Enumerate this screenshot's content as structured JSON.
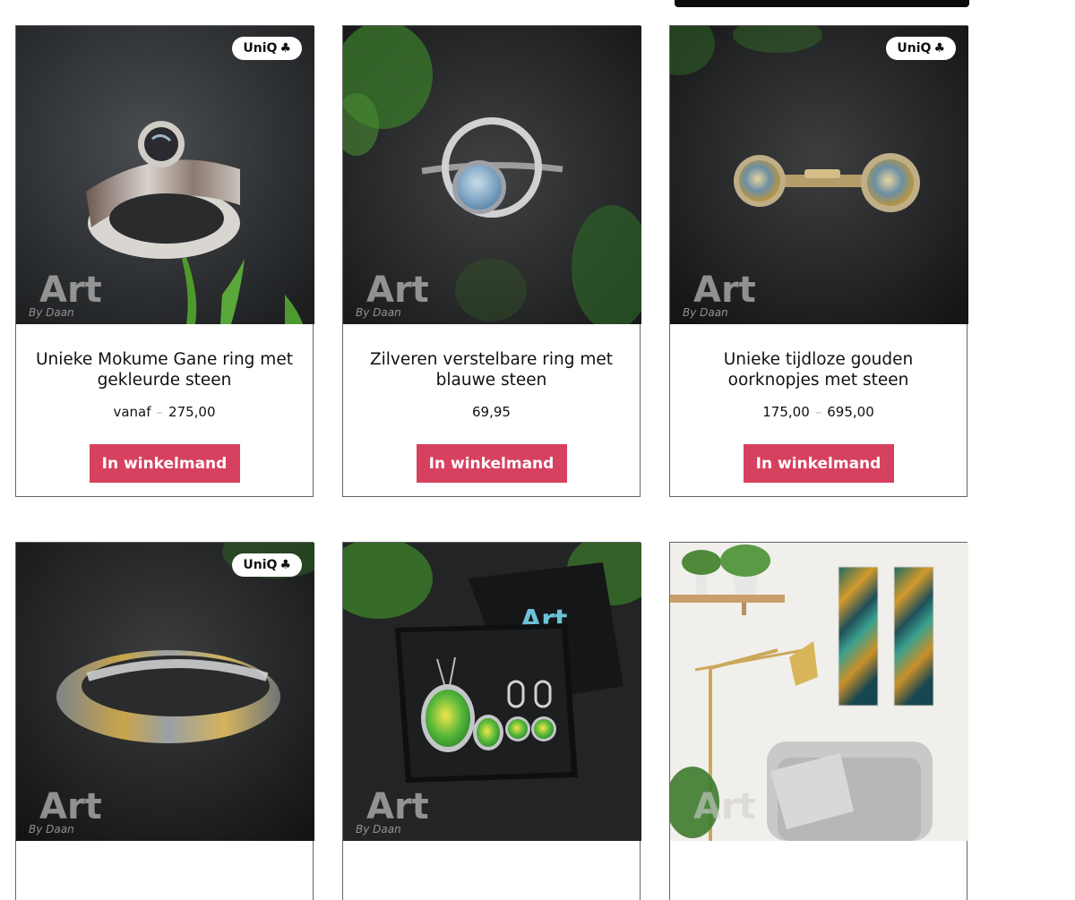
{
  "badge": {
    "label": "UniQ",
    "icon": "club-icon",
    "glyph": "♣"
  },
  "watermark": {
    "main": "Art",
    "sub": "By Daan"
  },
  "colors": {
    "button": "#d6415f",
    "card_border": "#666666"
  },
  "products": [
    {
      "title": "Unieke Mokume Gane ring met gekleurde steen",
      "price_prefix": "vanaf",
      "price_from": "",
      "price_to": "275,00",
      "button": "In winkelmand",
      "badge": true
    },
    {
      "title": "Zilveren verstelbare ring met blauwe steen",
      "price_prefix": "",
      "price_from": "",
      "price_to": "69,95",
      "button": "In winkelmand",
      "badge": false
    },
    {
      "title": "Unieke tijdloze gouden oorknopjes met steen",
      "price_prefix": "",
      "price_from": "175,00",
      "price_to": "695,00",
      "button": "In winkelmand",
      "badge": true
    },
    {
      "badge": true
    },
    {
      "box_text": "Art",
      "badge": false
    },
    {
      "badge": false
    }
  ]
}
